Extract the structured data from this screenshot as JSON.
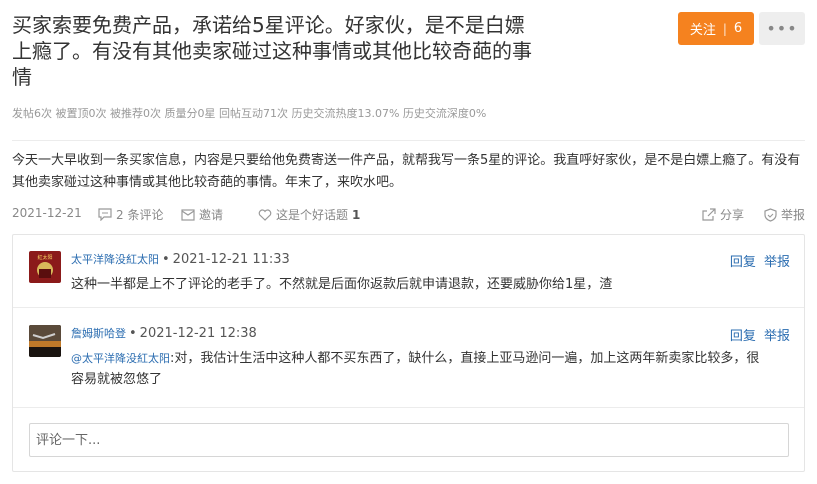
{
  "post": {
    "title": "买家索要免费产品，承诺给5星评论。好家伙，是不是白嫖上瘾了。有没有其他卖家碰过这种事情或其他比较奇葩的事情",
    "stats": "发帖6次 被置顶0次 被推荐0次 质量分0星 回帖互动71次 历史交流热度13.07% 历史交流深度0%",
    "content": "今天一大早收到一条买家信息，内容是只要给他免费寄送一件产品，就帮我写一条5星的评论。我直呼好家伙，是不是白嫖上瘾了。有没有其他卖家碰过这种事情或其他比较奇葩的事情。年末了，来吹水吧。"
  },
  "header": {
    "follow_label": "关注",
    "follow_count": "6",
    "more_label": "•••"
  },
  "actions": {
    "date": "2021-12-21",
    "comments_label": "2 条评论",
    "invite_label": "邀请",
    "good_question_label": "这是个好话题",
    "good_question_count": "1",
    "share_label": "分享",
    "report_label": "举报"
  },
  "comments": [
    {
      "user": "太平洋降没紅太阳",
      "time": "2021-12-21 11:33",
      "reply_label": "回复",
      "report_label": "举报",
      "text": "这种一半都是上不了评论的老手了。不然就是后面你返款后就申请退款，还要威胁你给1星，渣",
      "avatar_text": "紅太阳"
    },
    {
      "user": "詹姆斯哈登",
      "time": "2021-12-21 12:38",
      "reply_label": "回复",
      "report_label": "举报",
      "mention": "@太平洋降没紅太阳",
      "text": ":对，我估计生活中这种人都不买东西了，缺什么，直接上亚马逊问一遍，加上这两年新卖家比较多，很容易就被忽悠了"
    }
  ],
  "comment_input": {
    "placeholder": "评论一下..."
  },
  "colors": {
    "accent": "#f5821f",
    "link": "#2a6cb0"
  }
}
